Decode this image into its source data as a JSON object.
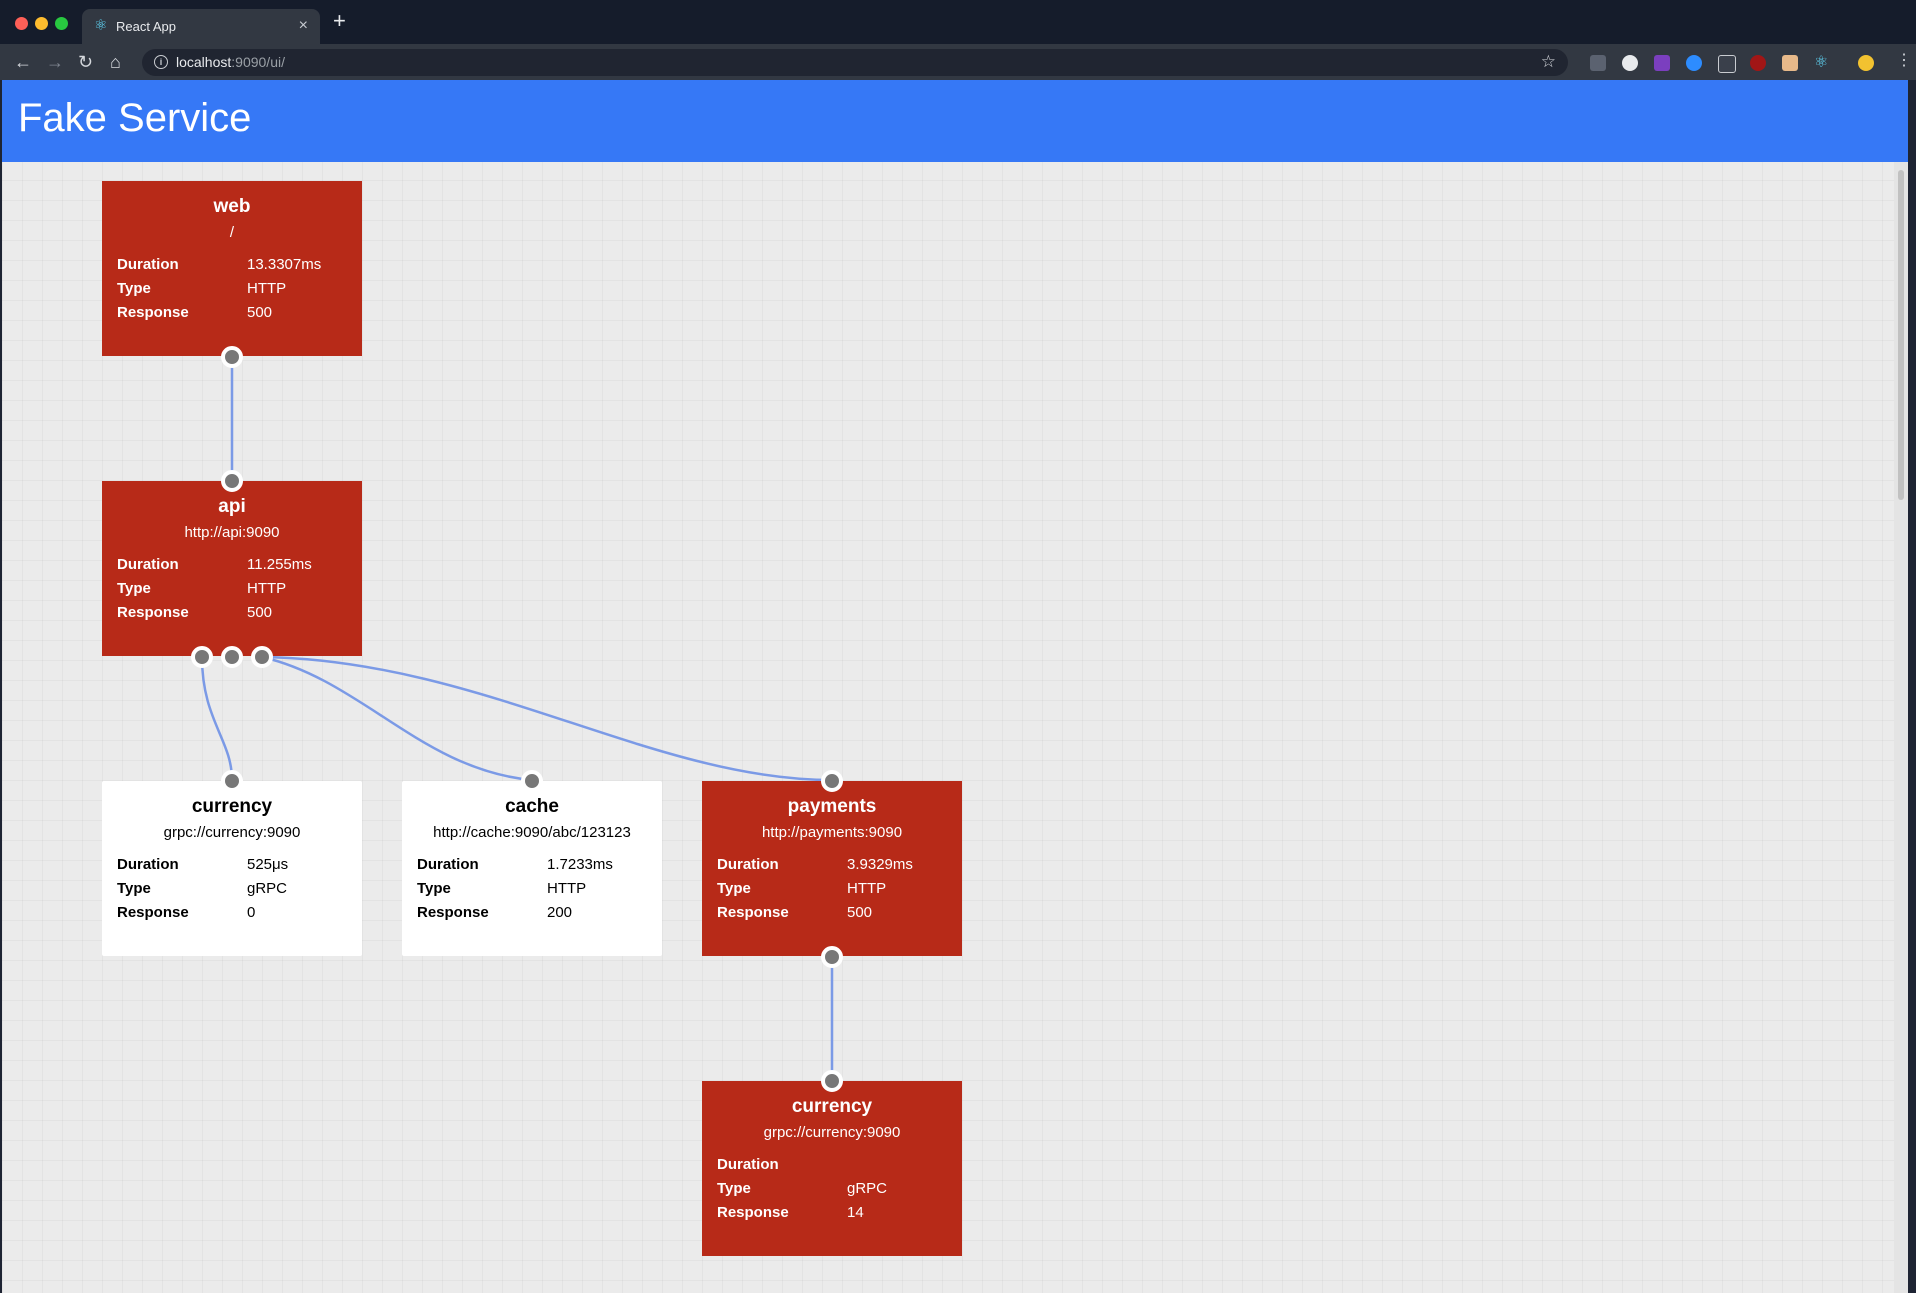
{
  "browser": {
    "tab_title": "React App",
    "url_host": "localhost",
    "url_path": ":9090/ui/"
  },
  "app": {
    "title": "Fake Service"
  },
  "labels": {
    "duration": "Duration",
    "type": "Type",
    "response": "Response"
  },
  "colors": {
    "header": "#3678f6",
    "error_node": "#b72a18",
    "ok_node": "#ffffff",
    "edge": "#7b9ae6"
  },
  "nodes": {
    "web": {
      "name": "web",
      "url": "/",
      "duration": "13.3307ms",
      "type": "HTTP",
      "response": "500",
      "status": "error"
    },
    "api": {
      "name": "api",
      "url": "http://api:9090",
      "duration": "11.255ms",
      "type": "HTTP",
      "response": "500",
      "status": "error"
    },
    "currency": {
      "name": "currency",
      "url": "grpc://currency:9090",
      "duration": "525μs",
      "type": "gRPC",
      "response": "0",
      "status": "ok"
    },
    "cache": {
      "name": "cache",
      "url": "http://cache:9090/abc/123123",
      "duration": "1.7233ms",
      "type": "HTTP",
      "response": "200",
      "status": "ok"
    },
    "payments": {
      "name": "payments",
      "url": "http://payments:9090",
      "duration": "3.9329ms",
      "type": "HTTP",
      "response": "500",
      "status": "error"
    },
    "currency2": {
      "name": "currency",
      "url": "grpc://currency:9090",
      "duration": "",
      "type": "gRPC",
      "response": "14",
      "status": "error"
    }
  },
  "edges": [
    {
      "from": "web",
      "to": "api"
    },
    {
      "from": "api",
      "to": "currency"
    },
    {
      "from": "api",
      "to": "cache"
    },
    {
      "from": "api",
      "to": "payments"
    },
    {
      "from": "payments",
      "to": "currency2"
    }
  ]
}
